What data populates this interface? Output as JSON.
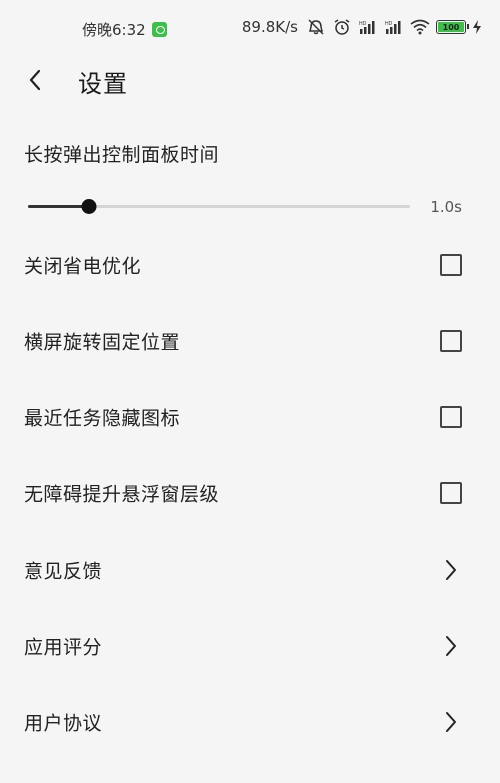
{
  "status_bar": {
    "time": "傍晚6:32",
    "net_speed": "89.8K/s",
    "battery": "100"
  },
  "header": {
    "title": "设置"
  },
  "slider": {
    "label": "长按弹出控制面板时间",
    "value_text": "1.0s",
    "fraction": 0.16
  },
  "settings": {
    "checkbox_items": [
      {
        "label": "关闭省电优化",
        "checked": false
      },
      {
        "label": "横屏旋转固定位置",
        "checked": false
      },
      {
        "label": "最近任务隐藏图标",
        "checked": false
      },
      {
        "label": "无障碍提升悬浮窗层级",
        "checked": false
      }
    ],
    "link_items": [
      {
        "label": "意见反馈"
      },
      {
        "label": "应用评分"
      },
      {
        "label": "用户协议"
      }
    ]
  },
  "colors": {
    "background": "#f5f5f5",
    "accent_green": "#3cc04a",
    "text_primary": "#222222"
  }
}
